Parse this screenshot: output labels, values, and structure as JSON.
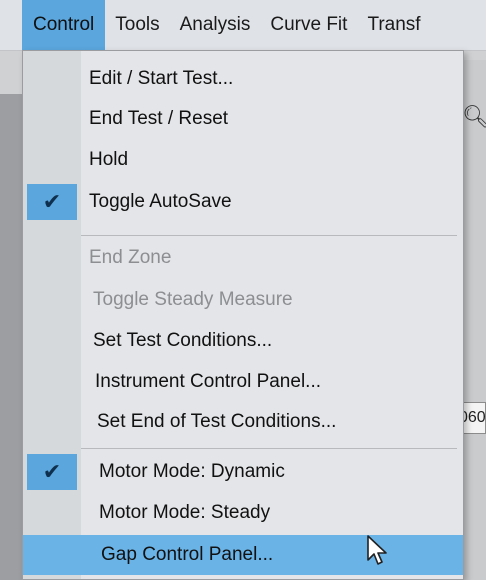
{
  "menubar": {
    "items": [
      "Control",
      "Tools",
      "Analysis",
      "Curve Fit",
      "Transf"
    ]
  },
  "control_menu": {
    "items": [
      {
        "label": "Edit / Start Test...",
        "enabled": true,
        "checked": false
      },
      {
        "label": "End Test / Reset",
        "enabled": true,
        "checked": false
      },
      {
        "label": "Hold",
        "enabled": true,
        "checked": false
      },
      {
        "label": "Toggle AutoSave",
        "enabled": true,
        "checked": true
      },
      {
        "label": "End Zone",
        "enabled": false,
        "checked": false
      },
      {
        "label": "Toggle Steady Measure",
        "enabled": false,
        "checked": false
      },
      {
        "label": "Set Test Conditions...",
        "enabled": true,
        "checked": false
      },
      {
        "label": "Instrument Control Panel...",
        "enabled": true,
        "checked": false
      },
      {
        "label": "Set End of Test Conditions...",
        "enabled": true,
        "checked": false
      },
      {
        "label": "Motor Mode: Dynamic",
        "enabled": true,
        "checked": true
      },
      {
        "label": "Motor Mode: Steady",
        "enabled": true,
        "checked": false
      },
      {
        "label": "Gap Control Panel...",
        "enabled": true,
        "checked": false,
        "highlighted": true
      }
    ],
    "check_glyph": "✔"
  },
  "background": {
    "partial_value": "060",
    "search_icon": "search-icon"
  },
  "colors": {
    "menu_active": "#5aa6dd",
    "menu_highlight": "#6ab3e6",
    "menu_bg": "#e3e5e8",
    "disabled_text": "#8c8e91"
  }
}
